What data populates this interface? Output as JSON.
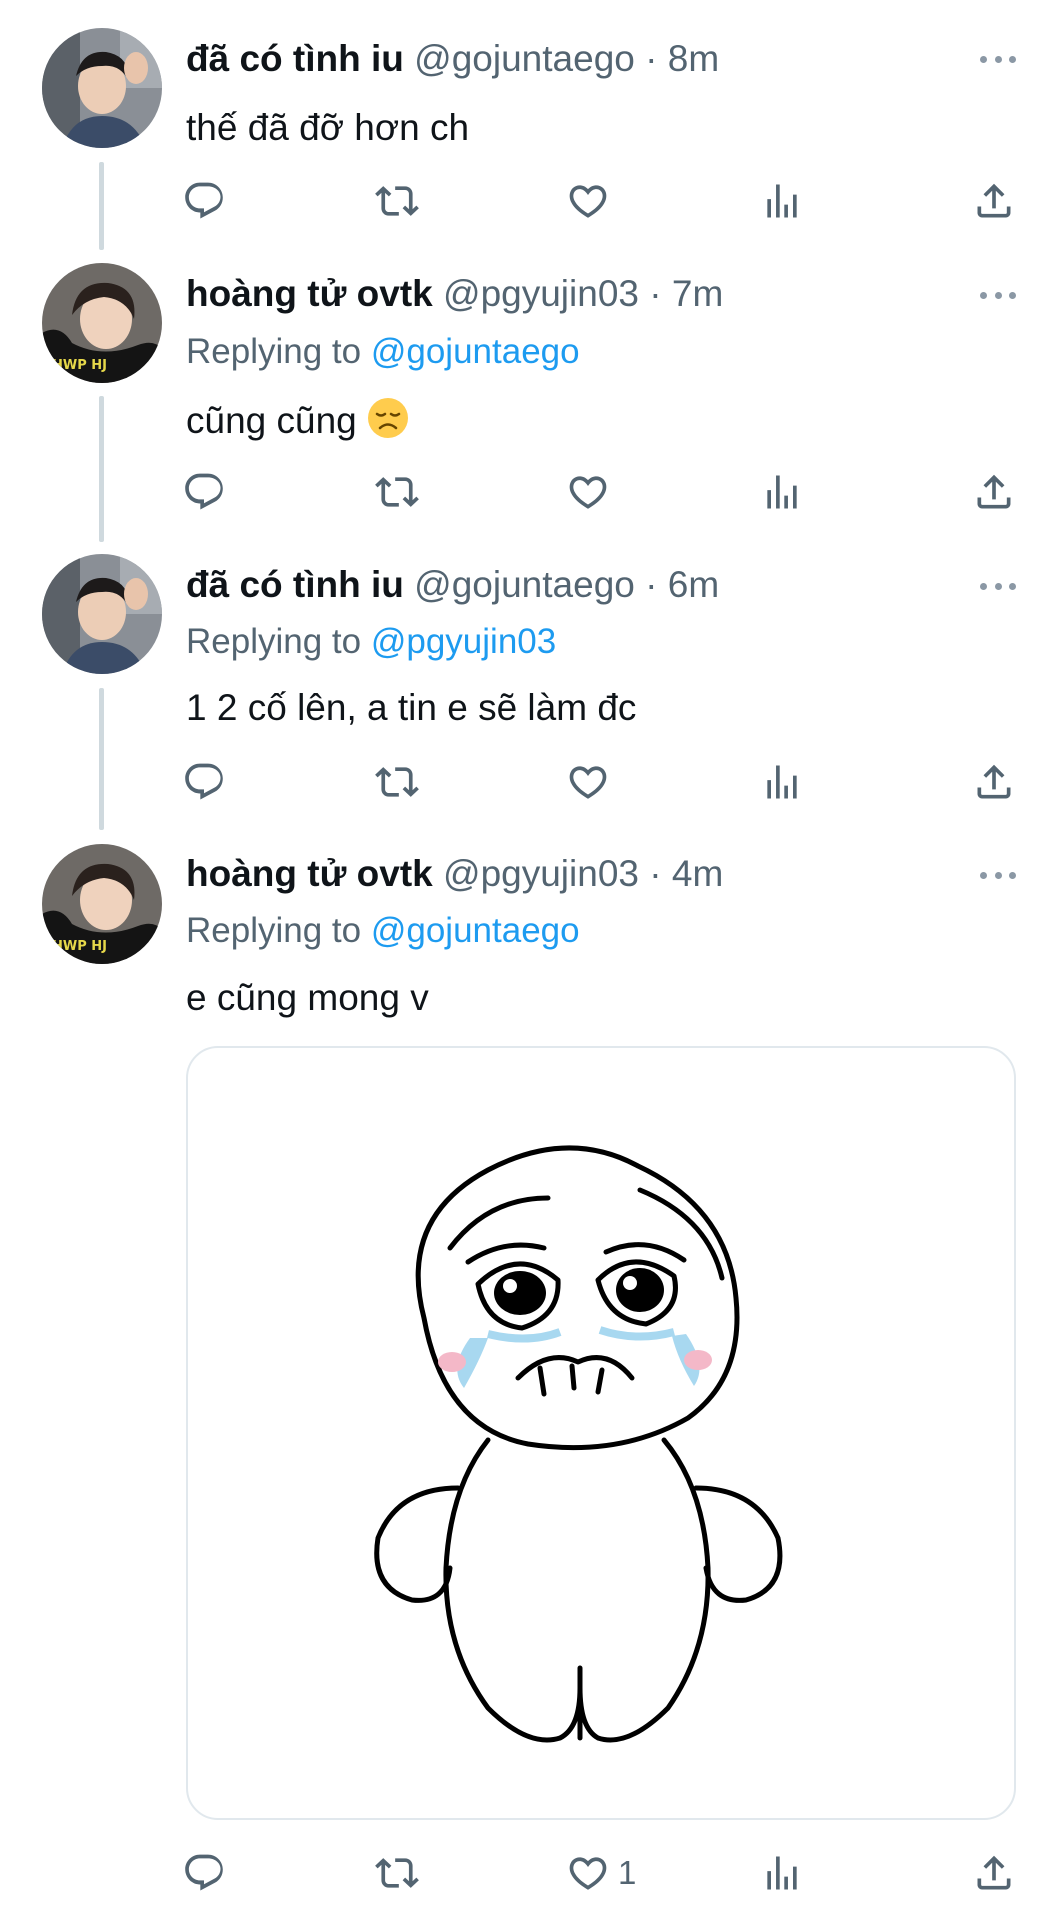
{
  "tweets": [
    {
      "display_name": "đã có tình iu",
      "handle": "@gojuntaego",
      "time": "· 8m",
      "replying_prefix": "",
      "replying_to": "",
      "text": "thế đã đỡ hơn ch",
      "likes": ""
    },
    {
      "display_name": "hoàng tử ovtk",
      "handle": "@pgyujin03",
      "time": "· 7m",
      "replying_prefix": "Replying to",
      "replying_to": "@gojuntaego",
      "text": "cũng cũng",
      "likes": ""
    },
    {
      "display_name": "đã có tình iu",
      "handle": "@gojuntaego",
      "time": "· 6m",
      "replying_prefix": "Replying to",
      "replying_to": "@pgyujin03",
      "text": "1 2 cố lên, a tin e sẽ làm đc",
      "likes": ""
    },
    {
      "display_name": "hoàng tử ovtk",
      "handle": "@pgyujin03",
      "time": "· 4m",
      "replying_prefix": "Replying to",
      "replying_to": "@gojuntaego",
      "text": "e cũng mong v",
      "likes": "1"
    }
  ],
  "icons": {
    "reply": "reply-icon",
    "retweet": "retweet-icon",
    "like": "heart-icon",
    "views": "analytics-icon",
    "share": "share-icon",
    "more": "more-icon"
  },
  "colors": {
    "link": "#1d9bf0",
    "secondary": "#536471",
    "thread_line": "#cfd9de",
    "icon": "#536471"
  }
}
